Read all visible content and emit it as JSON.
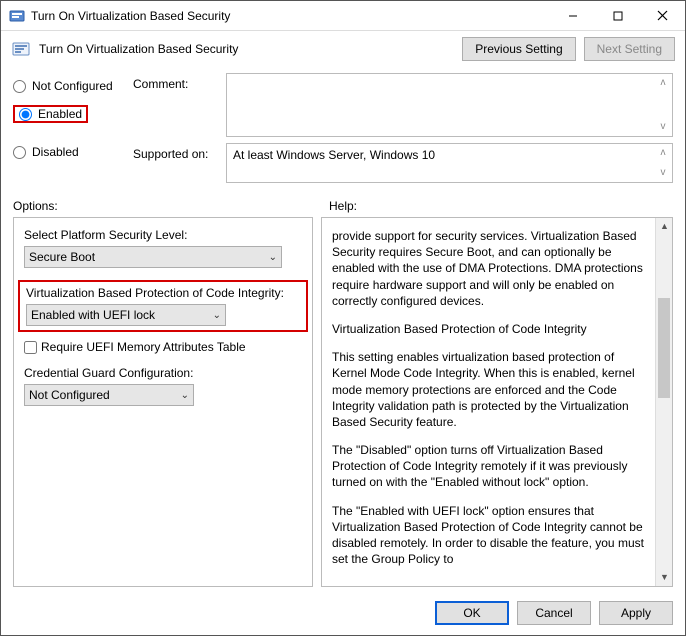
{
  "window": {
    "title": "Turn On Virtualization Based Security"
  },
  "header": {
    "title": "Turn On Virtualization Based Security",
    "prev_label": "Previous Setting",
    "next_label": "Next Setting"
  },
  "state": {
    "not_configured": "Not Configured",
    "enabled": "Enabled",
    "disabled": "Disabled"
  },
  "comment": {
    "label": "Comment:",
    "value": ""
  },
  "supported": {
    "label": "Supported on:",
    "value": "At least Windows Server, Windows 10"
  },
  "columns": {
    "options": "Options:",
    "help": "Help:"
  },
  "options": {
    "platform_label": "Select Platform Security Level:",
    "platform_value": "Secure Boot",
    "vbp_label": "Virtualization Based Protection of Code Integrity:",
    "vbp_value": "Enabled with UEFI lock",
    "uefi_chk": "Require UEFI Memory Attributes Table",
    "credguard_label": "Credential Guard Configuration:",
    "credguard_value": "Not Configured"
  },
  "help": {
    "p1": "provide support for security services. Virtualization Based Security requires Secure Boot, and can optionally be enabled with the use of DMA Protections. DMA protections require hardware support and will only be enabled on correctly configured devices.",
    "p2": "Virtualization Based Protection of Code Integrity",
    "p3": "This setting enables virtualization based protection of Kernel Mode Code Integrity. When this is enabled, kernel mode memory protections are enforced and the Code Integrity validation path is protected by the Virtualization Based Security feature.",
    "p4": "The \"Disabled\" option turns off Virtualization Based Protection of Code Integrity remotely if it was previously turned on with the \"Enabled without lock\" option.",
    "p5": "The \"Enabled with UEFI lock\" option ensures that Virtualization Based Protection of Code Integrity cannot be disabled remotely. In order to disable the feature, you must set the Group Policy to"
  },
  "footer": {
    "ok": "OK",
    "cancel": "Cancel",
    "apply": "Apply"
  }
}
